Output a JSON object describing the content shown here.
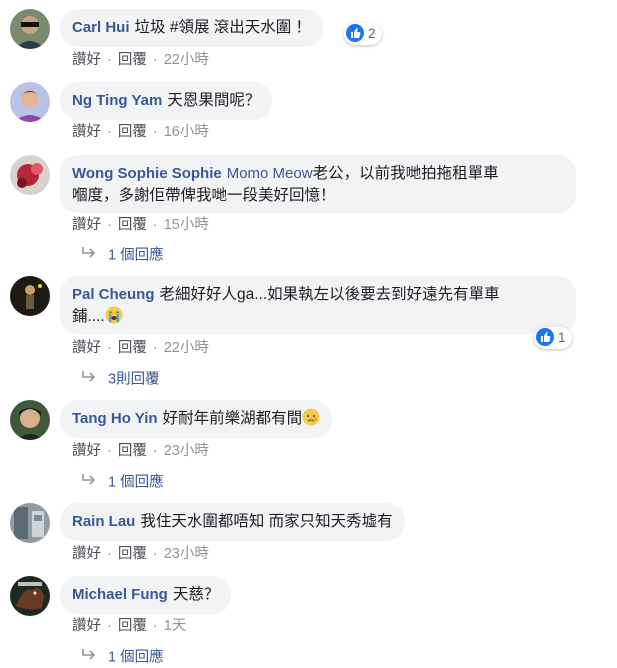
{
  "labels": {
    "like": "讚好",
    "reply": "回覆",
    "dot": "·"
  },
  "comments": [
    {
      "name": "Carl Hui",
      "text": "垃圾 #領展 滾出天水圍 ！",
      "time": "22小時",
      "reaction_count": "2"
    },
    {
      "name": "Ng Ting Yam",
      "text": "天恩果間呢？",
      "time": "16小時"
    },
    {
      "name": "Wong Sophie Sophie",
      "mention": "Momo Meow",
      "text_line1": "老公，以前我哋拍拖租單車",
      "text_line2": "嗰度，多謝佢帶俾我哋一段美好回憶！",
      "time": "15小時",
      "replies": "1 個回應"
    },
    {
      "name": "Pal Cheung",
      "text_line1": "老細好好人ga...如果執左以後要去到好遠先有單車",
      "text_line2": "鋪....",
      "emoji": "loudly-crying-face",
      "time": "22小時",
      "reaction_count": "1",
      "replies": "3則回覆"
    },
    {
      "name": "Tang Ho Yin",
      "text": "好耐年前樂湖都有間",
      "emoji": "sad-relieved-face",
      "time": "23小時",
      "replies": "1 個回應"
    },
    {
      "name": "Rain Lau",
      "text": "我住天水圍都唔知 而家只知天秀墟有",
      "time": "23小時"
    },
    {
      "name": "Michael Fung",
      "text": "天慈？",
      "time": "1天",
      "replies": "1 個回應"
    }
  ],
  "colors": {
    "name": "#385898",
    "bubble": "#f2f3f5",
    "like": "#1877f2",
    "meta": "#90949c"
  }
}
